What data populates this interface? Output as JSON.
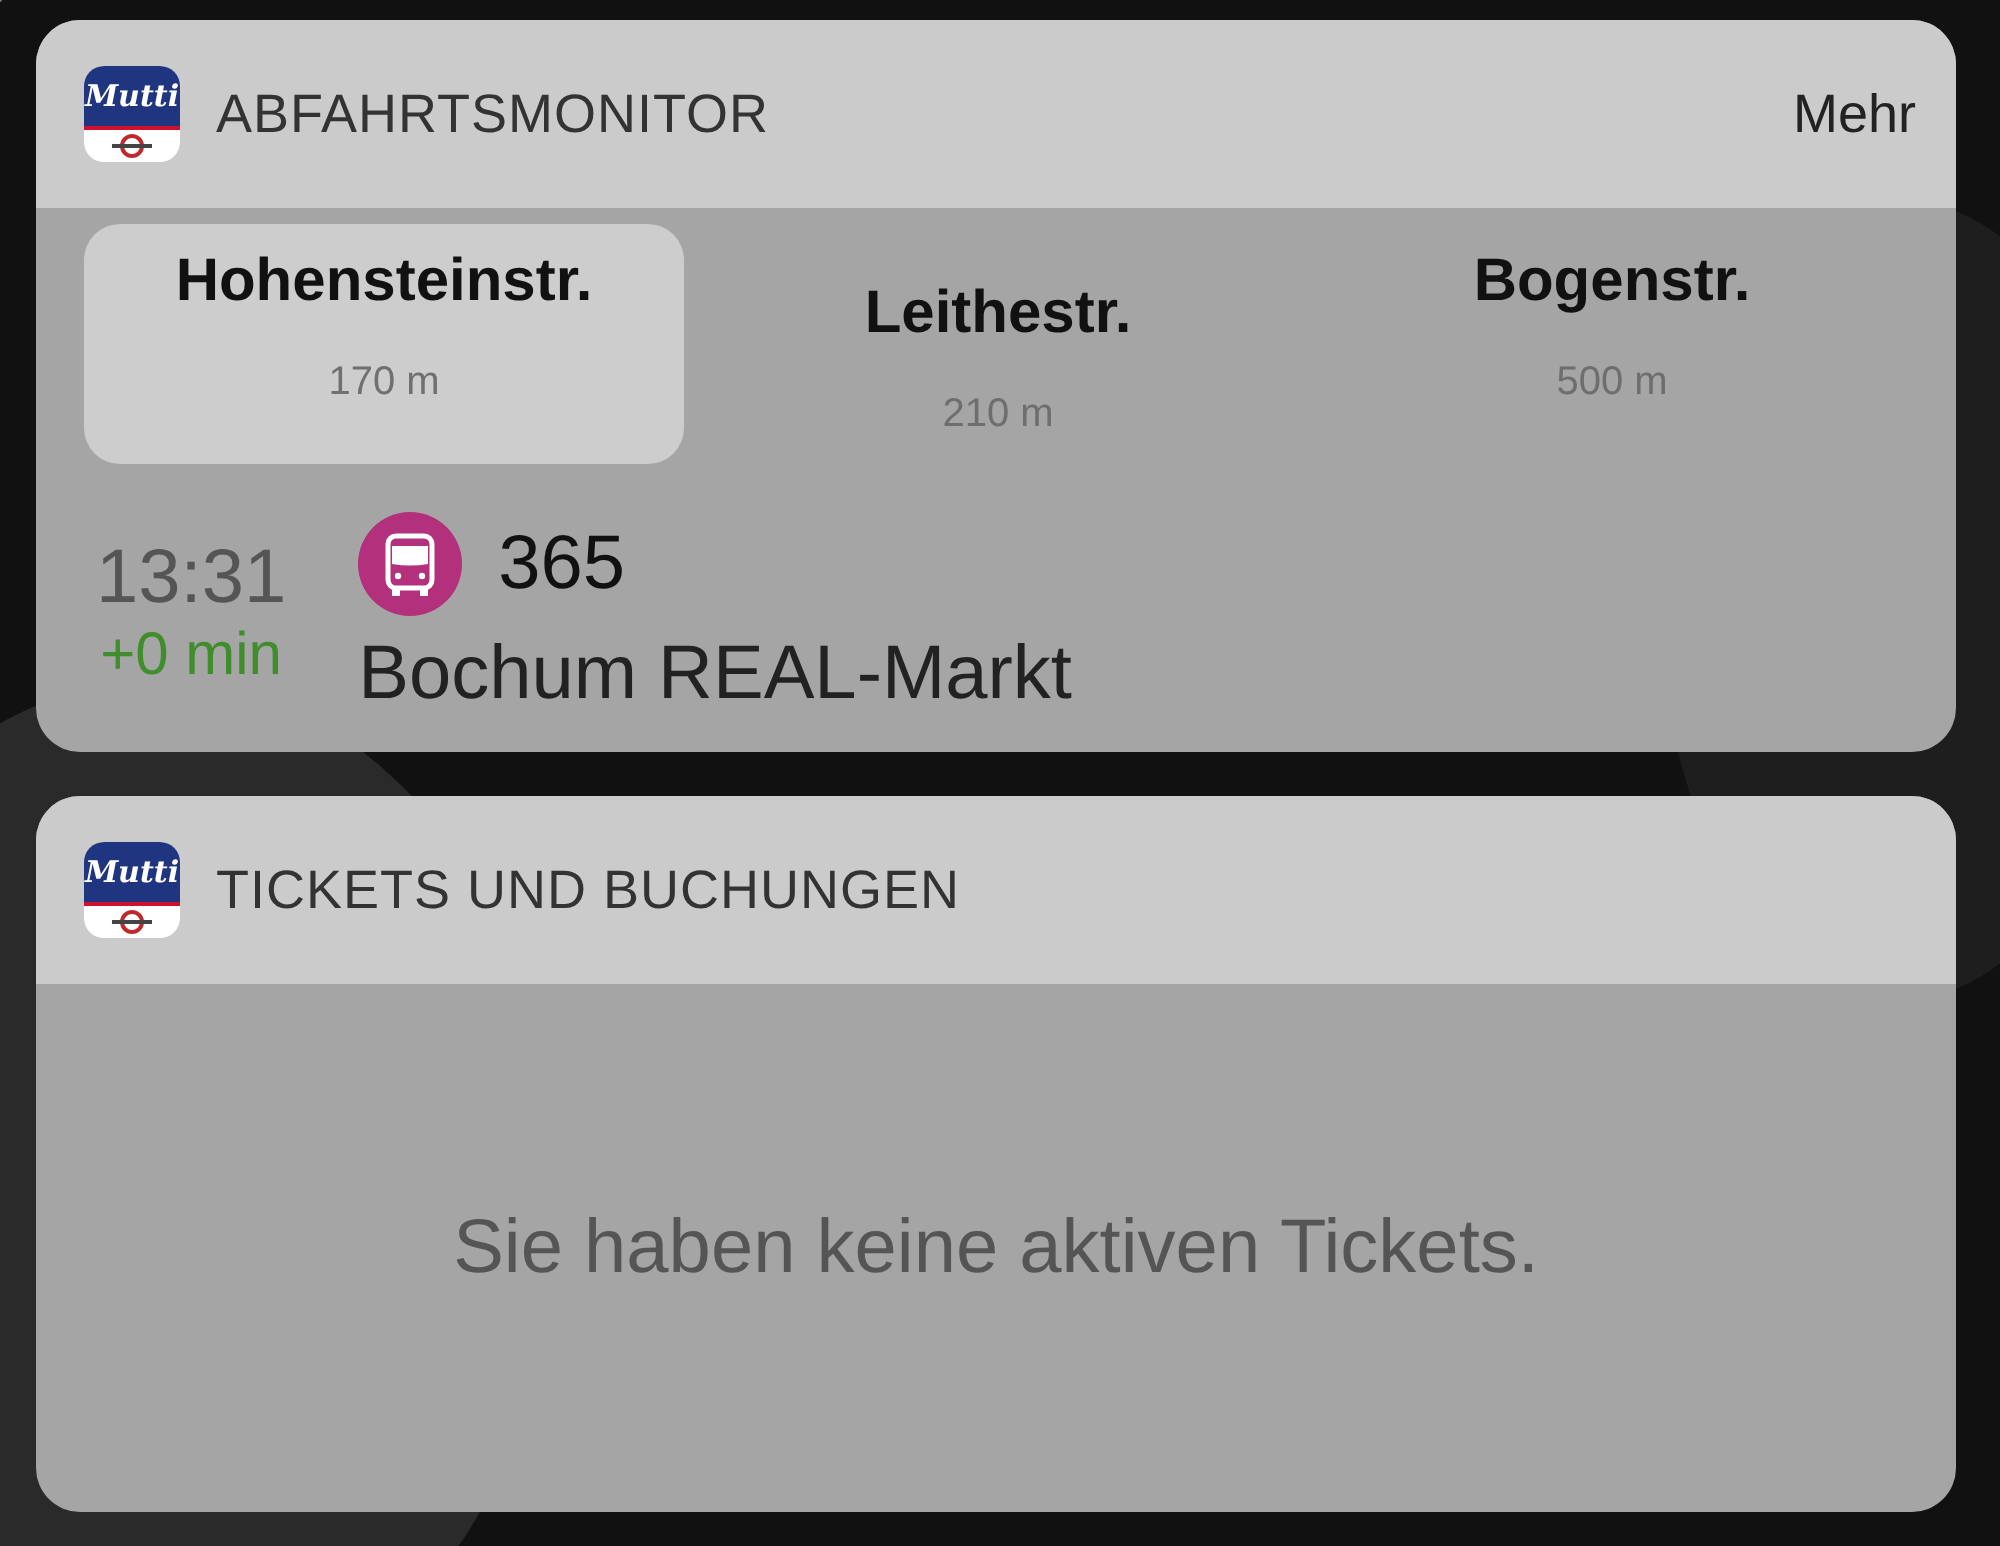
{
  "widgets": [
    {
      "kind": "departures",
      "app_icon": "Mutti",
      "title": "ABFAHRTSMONITOR",
      "action": "Mehr",
      "stops": [
        {
          "name": "Hohensteinstr.",
          "distance": "170 m",
          "selected": true
        },
        {
          "name": "Leithestr.",
          "distance": "210 m",
          "selected": false
        },
        {
          "name": "Bogenstr.",
          "distance": "500 m",
          "selected": false
        }
      ],
      "departure": {
        "time": "13:31",
        "delay": "+0 min",
        "line": "365",
        "destination": "Bochum REAL-Markt"
      }
    },
    {
      "kind": "message",
      "app_icon": "Mutti",
      "title": "TICKETS UND BUCHUNGEN",
      "message": "Sie haben keine aktiven Tickets."
    }
  ]
}
